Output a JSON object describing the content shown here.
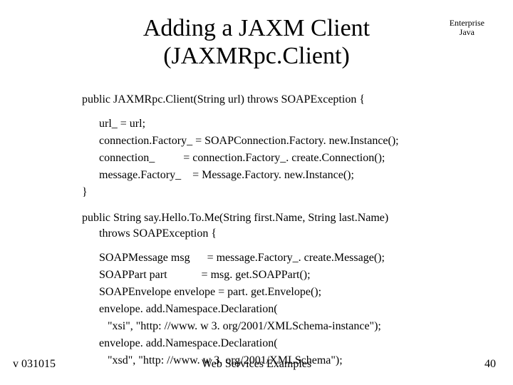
{
  "title": {
    "line1": "Adding a JAXM Client",
    "line2": "(JAXMRpc.Client)"
  },
  "corner": {
    "line1": "Enterprise",
    "line2": "Java"
  },
  "code": {
    "ctor_sig": "public JAXMRpc.Client(String url) throws SOAPException {",
    "ctor_body1": "url_ = url;",
    "ctor_body2": "connection.Factory_ = SOAPConnection.Factory. new.Instance();",
    "ctor_body3": "connection_          = connection.Factory_. create.Connection();",
    "ctor_body4": "message.Factory_    = Message.Factory. new.Instance();",
    "ctor_close": "}",
    "m2_sig": "public String say.Hello.To.Me(String first.Name, String last.Name)",
    "m2_throws": "throws SOAPException {",
    "m2_b1": "SOAPMessage msg      = message.Factory_. create.Message();",
    "m2_b2": "SOAPPart part            = msg. get.SOAPPart();",
    "m2_b3": "SOAPEnvelope envelope = part. get.Envelope();",
    "m2_b4": "envelope. add.Namespace.Declaration(",
    "m2_b5": "   \"xsi\", \"http: //www. w 3. org/2001/XMLSchema-instance\");",
    "m2_b6": "envelope. add.Namespace.Declaration(",
    "m2_b7": "   \"xsd\", \"http: //www. w 3. org/2001/XMLSchema\");"
  },
  "footer": {
    "left": "v 031015",
    "center": "Web Services Examples",
    "right": "40"
  }
}
